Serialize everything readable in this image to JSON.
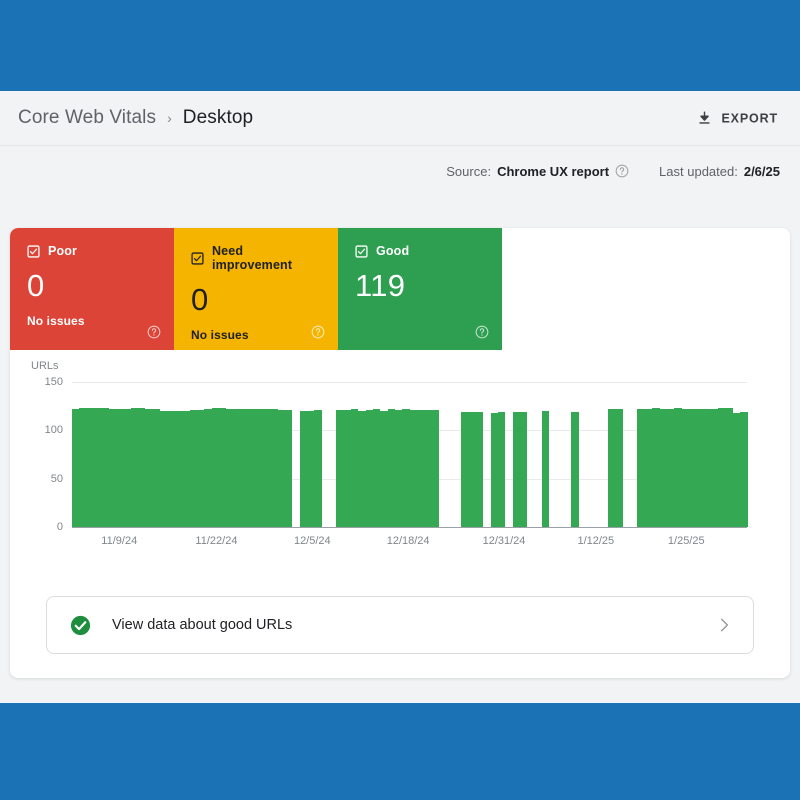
{
  "theme": {
    "page_background": "#1b73b6",
    "console_background": "#f1f3f4",
    "poor_color": "#dc4437",
    "need_improvement_color": "#f4b400",
    "good_color": "#2e9e51",
    "bar_color": "#34a853"
  },
  "header": {
    "breadcrumb_root": "Core Web Vitals",
    "breadcrumb_separator": "›",
    "breadcrumb_current": "Desktop",
    "export_label": "EXPORT",
    "export_icon": "download-icon"
  },
  "meta": {
    "source_label": "Source:",
    "source_value": "Chrome UX report",
    "source_help_icon": "help-circle-icon",
    "updated_label": "Last updated:",
    "updated_value": "2/6/25"
  },
  "tiles": [
    {
      "key": "poor",
      "checkbox_icon": "checkbox-checked-icon",
      "title": "Poor",
      "count": "0",
      "subtitle": "No issues",
      "help_icon": "help-circle-icon"
    },
    {
      "key": "need_improvement",
      "checkbox_icon": "checkbox-checked-icon",
      "title": "Need improvement",
      "count": "0",
      "subtitle": "No issues",
      "help_icon": "help-circle-icon"
    },
    {
      "key": "good",
      "checkbox_icon": "checkbox-checked-icon",
      "title": "Good",
      "count": "119",
      "subtitle": "",
      "help_icon": "help-circle-icon"
    }
  ],
  "chart_data": {
    "type": "bar",
    "title": "",
    "ylabel": "URLs",
    "xlabel": "",
    "ylim": [
      0,
      150
    ],
    "yticks": [
      0,
      50,
      100,
      150
    ],
    "grid": true,
    "legend": "none",
    "xtick_labels": [
      "11/9/24",
      "11/22/24",
      "12/5/24",
      "12/18/24",
      "12/31/24",
      "1/12/25",
      "1/25/25"
    ],
    "xtick_positions_pct": [
      7.0,
      21.4,
      35.6,
      49.8,
      64.0,
      77.6,
      91.0
    ],
    "series_name": "Good URLs",
    "note": "null = day with no reported data (gap in bars)",
    "values": [
      122,
      123,
      123,
      123,
      123,
      122,
      122,
      122,
      123,
      123,
      122,
      122,
      120,
      120,
      120,
      120,
      121,
      121,
      122,
      123,
      123,
      122,
      122,
      122,
      122,
      122,
      122,
      122,
      121,
      121,
      null,
      120,
      120,
      121,
      null,
      null,
      121,
      121,
      122,
      120,
      121,
      122,
      120,
      122,
      121,
      122,
      121,
      121,
      121,
      121,
      null,
      null,
      null,
      119,
      119,
      119,
      null,
      118,
      119,
      null,
      119,
      119,
      null,
      null,
      120,
      null,
      null,
      null,
      119,
      null,
      null,
      null,
      null,
      122,
      122,
      null,
      null,
      122,
      122,
      123,
      122,
      122,
      123,
      122,
      122,
      122,
      122,
      122,
      123,
      123,
      118,
      119
    ]
  },
  "footer_link": {
    "icon": "good-check-circle-icon",
    "label": "View data about good URLs",
    "chevron_icon": "chevron-right-icon"
  }
}
